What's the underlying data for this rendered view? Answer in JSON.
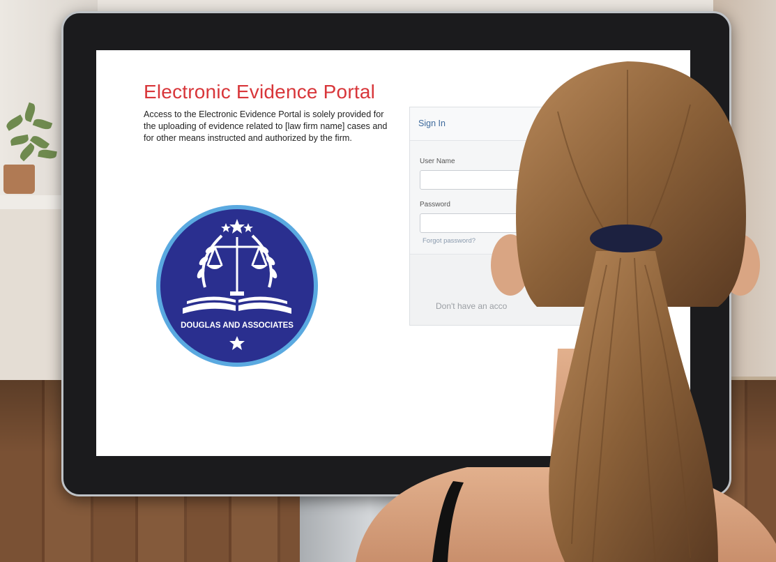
{
  "portal": {
    "title": "Electronic Evidence Portal",
    "description": "Access to the Electronic Evidence Portal is solely provided for the uploading of evidence related to [law firm name] cases and for other means instructed and authorized by the firm."
  },
  "logo": {
    "name": "DOUGLAS AND ASSOCIATES"
  },
  "signin": {
    "title": "Sign In",
    "username_label": "User Name",
    "username_value": "",
    "password_label": "Password",
    "password_value": "",
    "forgot_link": "Forgot password?",
    "signup_text": "Don't have an acco"
  },
  "colors": {
    "title_red": "#d8363a",
    "logo_blue": "#2a2f8f",
    "signin_blue": "#3d6a9c"
  }
}
